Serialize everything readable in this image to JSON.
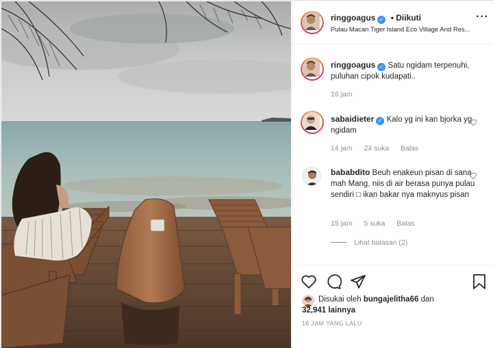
{
  "post": {
    "author": "ringgoagus",
    "follow_separator": "•",
    "follow_status": "Diikuti",
    "location": "Pulau Macan Tiger Island Eco Village And Res...",
    "more_icon": "more-horizontal-icon",
    "photo_alt": "Woman sitting on a wooden deck looking out at the sea"
  },
  "caption": {
    "author": "ringgoagus",
    "text": "Satu ngidam terpenuhi, puluhan cipok kudapati..",
    "time": "16 jam"
  },
  "comments": [
    {
      "author": "sabaidieter",
      "verified": true,
      "text": "Kalo yg ini kan bjorka yg ngidam",
      "time": "14 jam",
      "likes": "24 suka",
      "reply": "Balas"
    },
    {
      "author": "bababdito",
      "verified": false,
      "text": "Beuh enakeun pisan di sana mah Mang, niis di air berasa punya pulau sendiri □ ikan bakar nya maknyus pisan",
      "time": "15 jam",
      "likes": "5 suka",
      "reply": "Balas",
      "view_replies": "Lihat balasan (2)"
    }
  ],
  "actions": {
    "icons": [
      "heart-icon",
      "comment-icon",
      "share-icon",
      "bookmark-icon"
    ],
    "liked_by_prefix": "Disukai oleh",
    "liked_by_user": "bungajelitha66",
    "liked_by_and": "dan",
    "liked_by_count": "32,941 lainnya",
    "timestamp": "16 JAM YANG LALU"
  },
  "colors": {
    "verified": "#3897f0",
    "muted": "#8e8e8e",
    "text": "#262626",
    "border": "#efefef"
  }
}
